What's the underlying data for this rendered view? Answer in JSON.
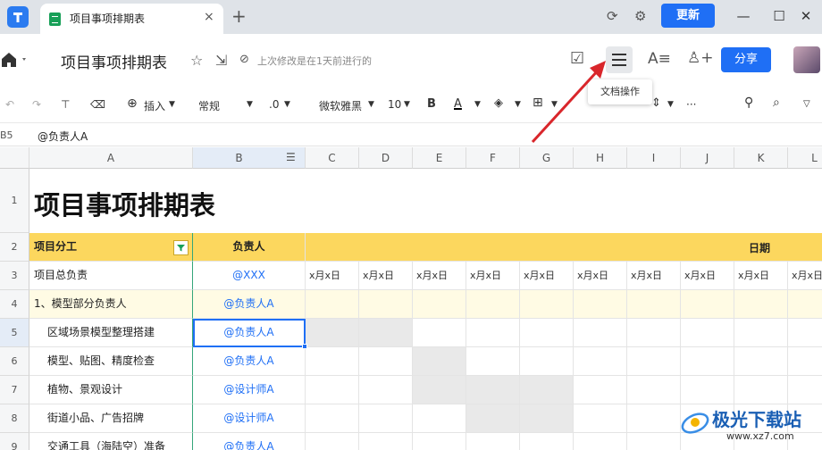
{
  "titlebar": {
    "tab_title": "项目事项排期表",
    "tab_close": "×",
    "new_tab": "+",
    "update_label": "更新",
    "minimize": "—",
    "maximize": "☐",
    "close": "✕"
  },
  "docbar": {
    "title": "项目事项排期表",
    "status": "上次修改是在1天前进行的",
    "share_label": "分享"
  },
  "tooltip": "文档操作",
  "toolbar": {
    "insert": "插入",
    "format": "常规",
    "decimal": ".0",
    "font": "微软雅黑",
    "size": "10",
    "bold": "B",
    "text_color": "A",
    "more": "···"
  },
  "formula": {
    "cell_ref": "B5",
    "value": "@负责人A"
  },
  "grid": {
    "columns": [
      "A",
      "B",
      "C",
      "D",
      "E",
      "F",
      "G",
      "H",
      "I",
      "J",
      "K",
      "L"
    ],
    "rows": [
      "1",
      "2",
      "3",
      "4",
      "5",
      "6",
      "7",
      "8",
      "9"
    ],
    "sheet_title": "项目事项排期表",
    "header": {
      "a": "项目分工",
      "b": "负责人",
      "date": "日期"
    },
    "date_label": "x月x日",
    "data_rows": [
      {
        "a": "项目总负责",
        "b": "@XXX"
      },
      {
        "a": "1、模型部分负责人",
        "b": "@负责人A"
      },
      {
        "a": "区域场景模型整理搭建",
        "b": "@负责人A"
      },
      {
        "a": "模型、贴图、精度检查",
        "b": "@负责人A"
      },
      {
        "a": "植物、景观设计",
        "b": "@设计师A"
      },
      {
        "a": "街道小品、广告招牌",
        "b": "@设计师A"
      },
      {
        "a": "交通工具（海陆空）准备",
        "b": "@负责人A"
      }
    ]
  },
  "watermark": {
    "text": "极光下载站",
    "url": "www.xz7.com"
  },
  "colors": {
    "accent": "#1f6ff5",
    "header_yellow": "#fcd75e",
    "arrow": "#d9262b"
  }
}
